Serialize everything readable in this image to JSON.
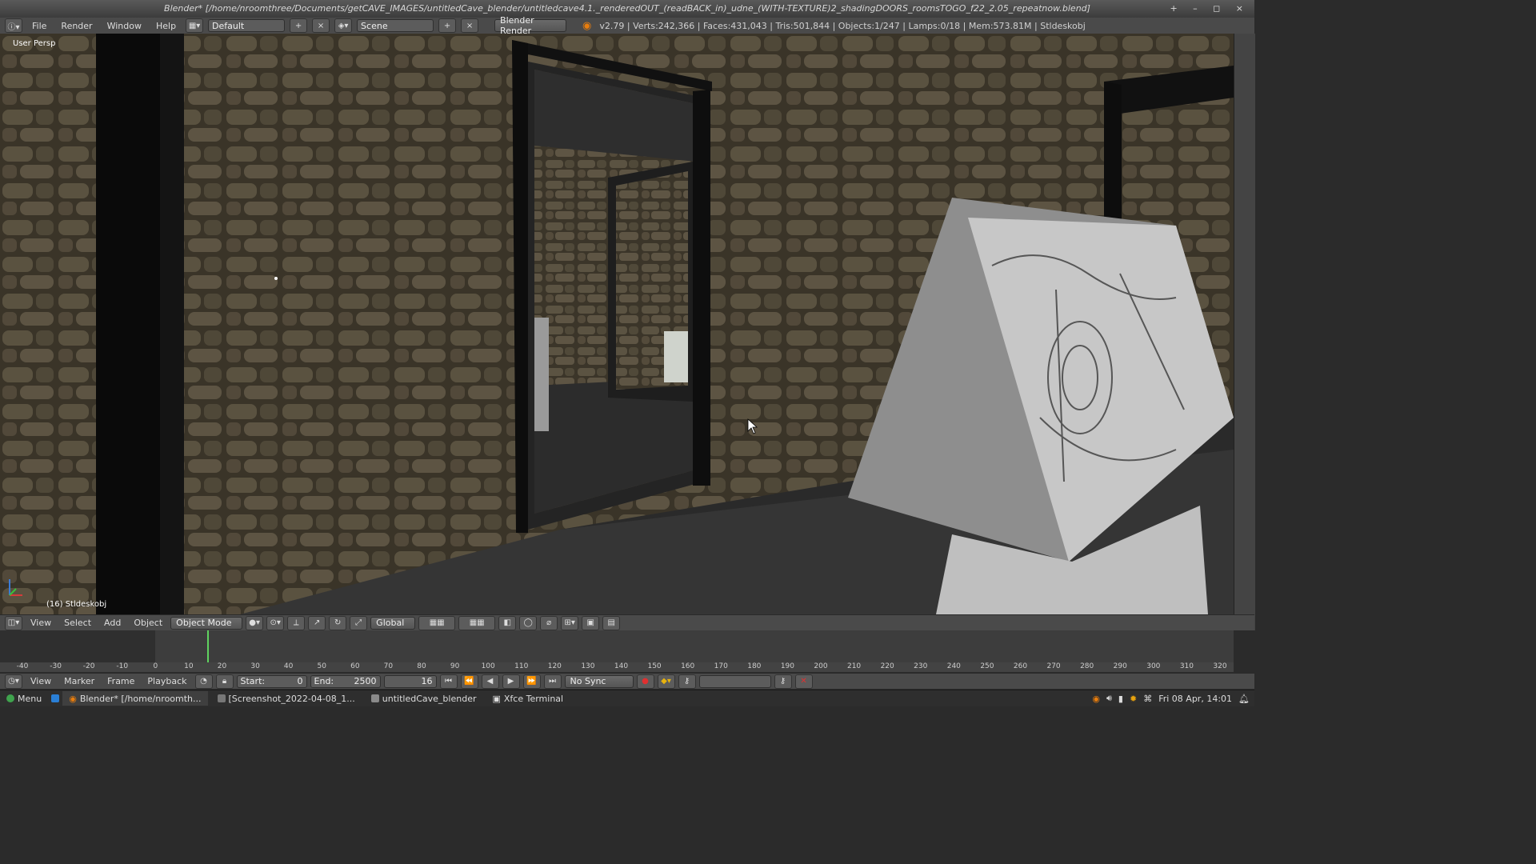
{
  "window": {
    "title": "Blender* [/home/nroomthree/Documents/getCAVE_IMAGES/untitledCave_blender/untitledcave4.1._renderedOUT_(readBACK_in)_udne_(WITH-TEXTURE)2_shadingDOORS_roomsTOGO_f22_2.05_repeatnow.blend]",
    "controls": "+ – ◻ ×"
  },
  "info_header": {
    "menus": [
      "File",
      "Render",
      "Window",
      "Help"
    ],
    "screen_layout": "Default",
    "scene": "Scene",
    "render_engine": "Blender Render",
    "stats": "v2.79 | Verts:242,366 | Faces:431,043 | Tris:501,844 | Objects:1/247 | Lamps:0/18 | Mem:573.81M | Stldeskobj"
  },
  "viewport": {
    "view_name": "User Persp",
    "object_info": "(16) Stldeskobj"
  },
  "view3d_header": {
    "menus": [
      "View",
      "Select",
      "Add",
      "Object"
    ],
    "mode": "Object Mode",
    "orientation": "Global"
  },
  "timeline": {
    "ticks": [
      "-40",
      "-30",
      "-20",
      "-10",
      "0",
      "10",
      "20",
      "30",
      "40",
      "50",
      "60",
      "70",
      "80",
      "90",
      "100",
      "110",
      "120",
      "130",
      "140",
      "150",
      "160",
      "170",
      "180",
      "190",
      "200",
      "210",
      "220",
      "230",
      "240",
      "250",
      "260",
      "270",
      "280",
      "290",
      "300",
      "310",
      "320"
    ],
    "current_frame_fraction": 0.16
  },
  "timeline_header": {
    "menus": [
      "View",
      "Marker",
      "Frame",
      "Playback"
    ],
    "start_label": "Start:",
    "start_value": "0",
    "end_label": "End:",
    "end_value": "2500",
    "current_frame": "16",
    "sync": "No Sync"
  },
  "taskbar": {
    "menu": "Menu",
    "tasks": [
      {
        "label": "Blender* [/home/nroomth...",
        "active": true
      },
      {
        "label": "[Screenshot_2022-04-08_1...",
        "active": false
      },
      {
        "label": "untitledCave_blender",
        "active": false
      },
      {
        "label": "Xfce Terminal",
        "active": false
      }
    ],
    "clock": "Fri 08 Apr, 14:01"
  },
  "colors": {
    "accent_orange": "#e87d0d",
    "playhead": "#5fd35f",
    "panel": "#4a4a4a"
  }
}
